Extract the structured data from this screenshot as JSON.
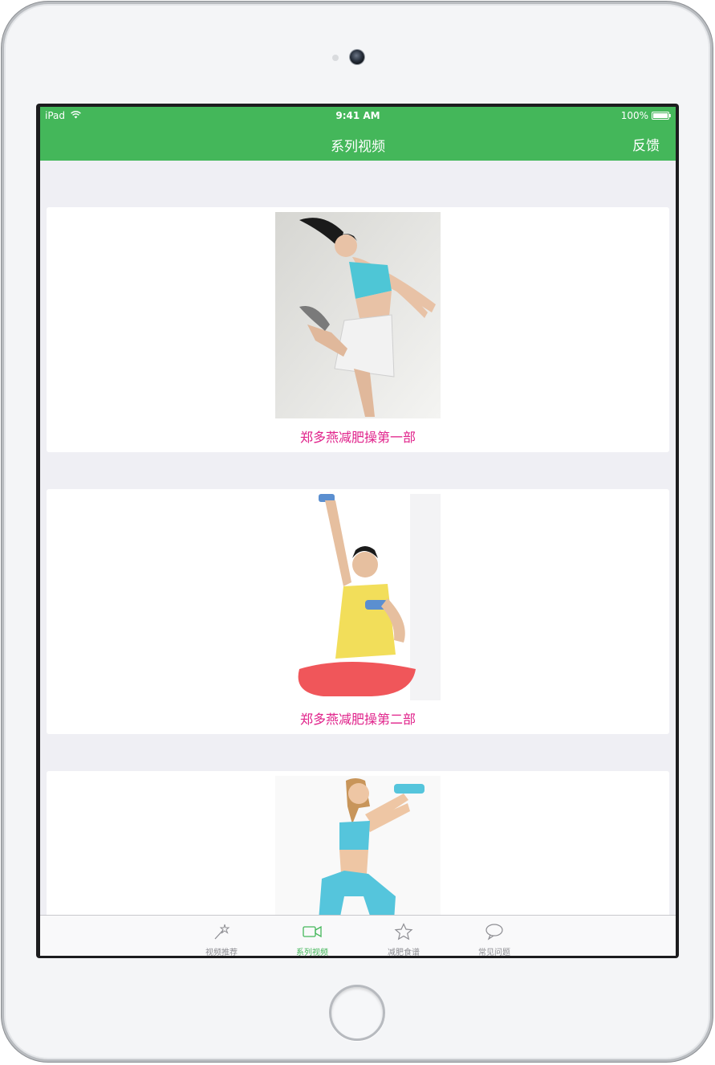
{
  "status_bar": {
    "device": "iPad",
    "time": "9:41 AM",
    "battery": "100%"
  },
  "nav": {
    "title": "系列视频",
    "feedback_label": "反馈"
  },
  "videos": [
    {
      "title": "郑多燕减肥操第一部"
    },
    {
      "title": "郑多燕减肥操第二部"
    },
    {
      "title": ""
    }
  ],
  "tabs": [
    {
      "label": "视频推荐",
      "icon": "magic-wand-icon",
      "active": false
    },
    {
      "label": "系列视频",
      "icon": "video-camera-icon",
      "active": true
    },
    {
      "label": "减肥食谱",
      "icon": "star-icon",
      "active": false
    },
    {
      "label": "常见问题",
      "icon": "speech-bubble-icon",
      "active": false
    }
  ],
  "colors": {
    "accent": "#44b75a",
    "title_pink": "#e0218a",
    "background": "#efeff4"
  }
}
